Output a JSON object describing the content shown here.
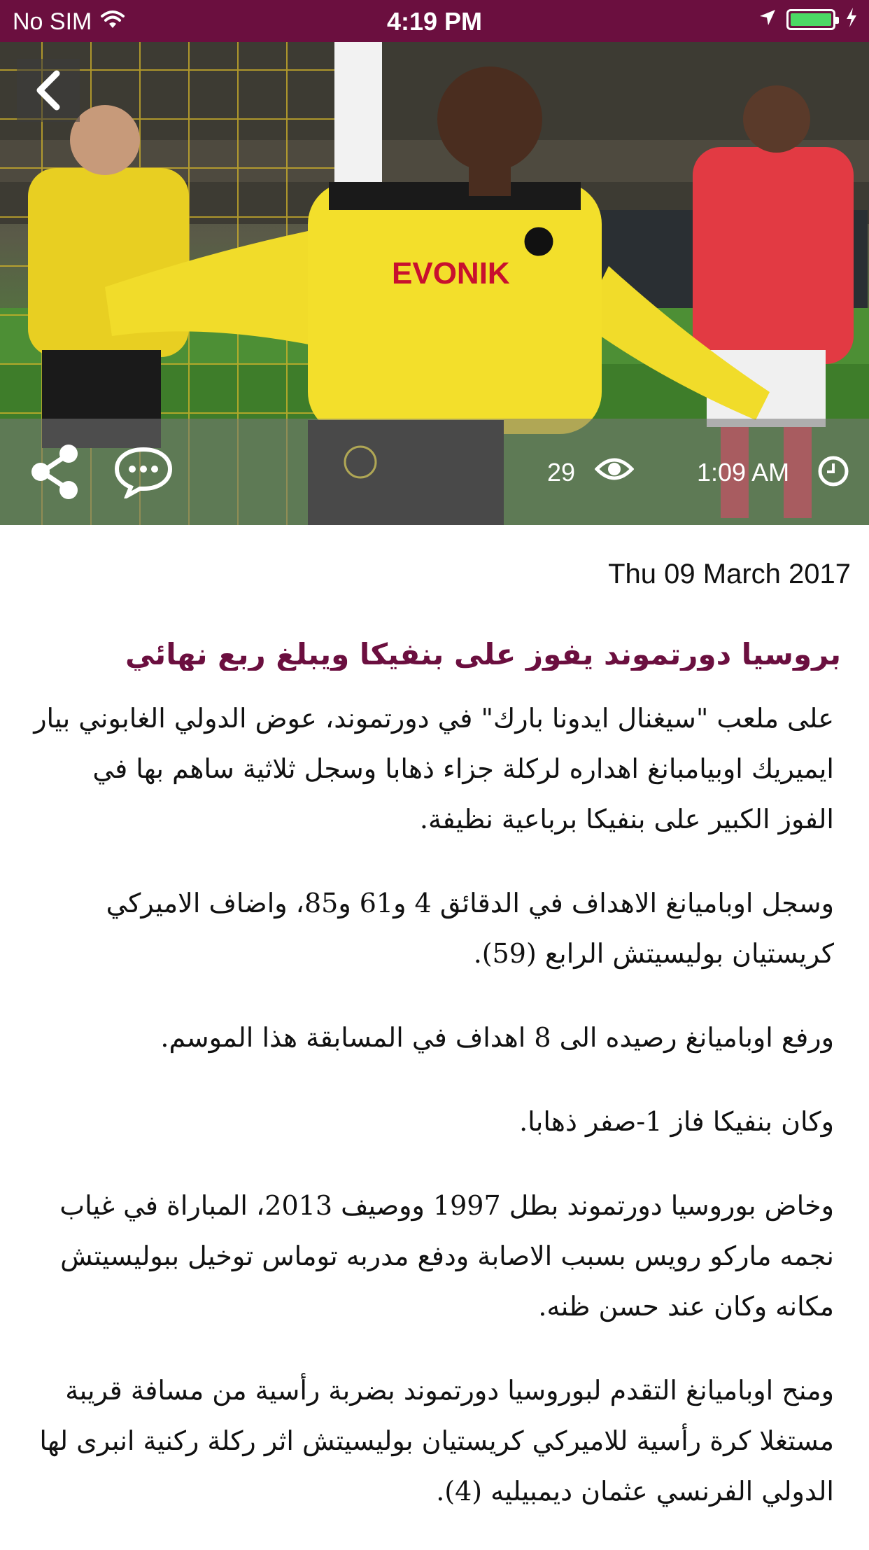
{
  "status_bar": {
    "carrier": "No SIM",
    "time": "4:19 PM",
    "wifi_icon": "wifi-icon",
    "location_icon": "location-arrow-icon",
    "battery_icon": "battery-icon",
    "charging_icon": "charging-bolt-icon"
  },
  "hero": {
    "image_alt": "Dortmund player celebrating",
    "back_icon": "chevron-left-icon",
    "share_icon": "share-icon",
    "comment_icon": "comment-icon",
    "views": "29",
    "eye_icon": "eye-icon",
    "time": "1:09 AM",
    "clock_icon": "clock-icon"
  },
  "article": {
    "date": "Thu 09 March 2017",
    "title": "بروسيا دورتموند يفوز على بنفيكا ويبلغ ربع نهائي",
    "paragraphs": [
      "على ملعب \"سيغنال ايدونا بارك\" في دورتموند، عوض الدولي الغابوني بيار ايميريك اوبيامبانغ اهداره لركلة جزاء ذهابا وسجل ثلاثية ساهم بها في الفوز الكبير على بنفيكا برباعية نظيفة.",
      "وسجل اوباميانغ الاهداف في الدقائق 4 و61 و85، واضاف الاميركي كريستيان بوليسيتش الرابع (59).",
      "ورفع اوباميانغ رصيده الى 8 اهداف في المسابقة هذا الموسم.",
      "وكان بنفيكا فاز 1-صفر ذهابا.",
      "وخاض بوروسيا دورتموند بطل 1997 ووصيف 2013، المباراة في غياب نجمه ماركو رويس بسبب الاصابة ودفع مدربه توماس توخيل ببوليسيتش مكانه وكان عند حسن ظنه.",
      "ومنح اوباميانغ التقدم لبوروسيا دورتموند بضربة رأسية من مسافة قريبة مستغلا كرة رأسية للاميركي كريستيان بوليسيتش اثر ركلة ركنية انبرى لها الدولي الفرنسي عثمان ديمبيليه (4)."
    ]
  },
  "colors": {
    "brand": "#6b0f3f",
    "status_bar": "#6b0f3f",
    "text": "#111111",
    "battery": "#4cd964"
  }
}
